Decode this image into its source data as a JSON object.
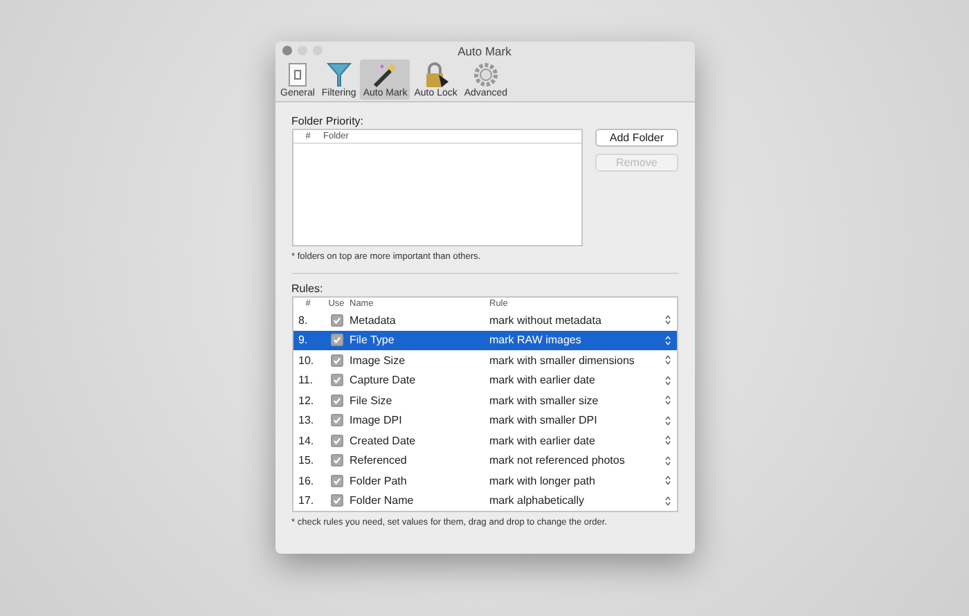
{
  "window": {
    "title": "Auto Mark"
  },
  "tabs": [
    {
      "label": "General",
      "selected": false
    },
    {
      "label": "Filtering",
      "selected": false
    },
    {
      "label": "Auto Mark",
      "selected": true
    },
    {
      "label": "Auto Lock",
      "selected": false
    },
    {
      "label": "Advanced",
      "selected": false
    }
  ],
  "folder_priority": {
    "label": "Folder Priority:",
    "columns": [
      "#",
      "Folder"
    ],
    "buttons": [
      {
        "label": "Add Folder",
        "disabled": false
      },
      {
        "label": "Remove",
        "disabled": true
      }
    ],
    "note": "* folders on top are more important than others."
  },
  "rules": {
    "label": "Rules:",
    "columns": [
      "#",
      "Use",
      "Name",
      "Rule"
    ],
    "rows": [
      {
        "num": "8.",
        "checked": true,
        "name": "Metadata",
        "rule": "mark without metadata",
        "selected": false
      },
      {
        "num": "9.",
        "checked": true,
        "name": "File Type",
        "rule": "mark RAW images",
        "selected": true
      },
      {
        "num": "10.",
        "checked": true,
        "name": "Image Size",
        "rule": "mark with smaller dimensions",
        "selected": false
      },
      {
        "num": "11.",
        "checked": true,
        "name": "Capture Date",
        "rule": "mark with earlier date",
        "selected": false
      },
      {
        "num": "12.",
        "checked": true,
        "name": "File Size",
        "rule": "mark with smaller size",
        "selected": false
      },
      {
        "num": "13.",
        "checked": true,
        "name": "Image DPI",
        "rule": "mark with smaller DPI",
        "selected": false
      },
      {
        "num": "14.",
        "checked": true,
        "name": "Created Date",
        "rule": "mark with earlier date",
        "selected": false
      },
      {
        "num": "15.",
        "checked": true,
        "name": "Referenced",
        "rule": "mark not referenced photos",
        "selected": false
      },
      {
        "num": "16.",
        "checked": true,
        "name": "Folder Path",
        "rule": "mark with longer path",
        "selected": false
      },
      {
        "num": "17.",
        "checked": true,
        "name": "Folder Name",
        "rule": "mark alphabetically",
        "selected": false
      }
    ],
    "note": "* check rules you need, set values for them, drag and drop to change the order."
  }
}
